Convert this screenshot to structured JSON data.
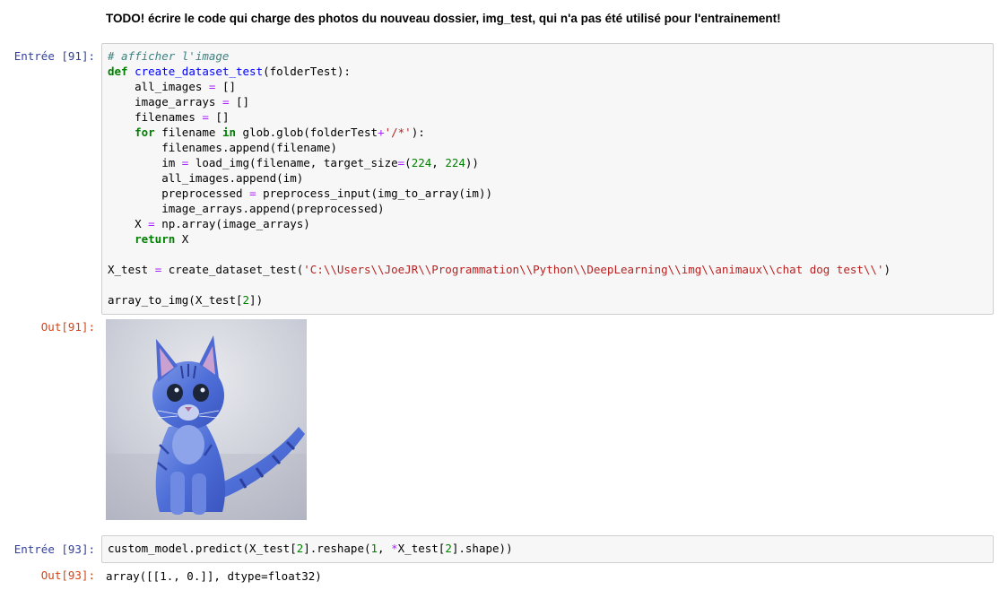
{
  "markdown": {
    "todo_text": "TODO! écrire le code qui charge des photos du nouveau dossier, img_test, qui n'a pas été utilisé pour l'entrainement!"
  },
  "cells": {
    "cell91": {
      "in_prompt": "Entrée [91]:",
      "out_prompt": "Out[91]:",
      "lines": {
        "l1": "# afficher l'image",
        "l2_def": "def",
        "l2_name": "create_dataset_test",
        "l2_rest": "(folderTest):",
        "l3_a": "all_images ",
        "l3_op": "=",
        "l3_b": " []",
        "l4_a": "image_arrays ",
        "l4_op": "=",
        "l4_b": " []",
        "l5_a": "filenames ",
        "l5_op": "=",
        "l5_b": " []",
        "l6_for": "for",
        "l6_a": " filename ",
        "l6_in": "in",
        "l6_b": " glob.glob(folderTest",
        "l6_op": "+",
        "l6_str": "'/*'",
        "l6_c": "):",
        "l7": "filenames.append(filename)",
        "l8_a": "im ",
        "l8_op": "=",
        "l8_b": " load_img(filename, target_size",
        "l8_op2": "=",
        "l8_c": "(",
        "l8_n1": "224",
        "l8_d": ", ",
        "l8_n2": "224",
        "l8_e": "))",
        "l9": "all_images.append(im)",
        "l10_a": "preprocessed ",
        "l10_op": "=",
        "l10_b": " preprocess_input(img_to_array(im))",
        "l11": "image_arrays.append(preprocessed)",
        "l12_a": "X ",
        "l12_op": "=",
        "l12_b": " np.array(image_arrays)",
        "l13_kw": "return",
        "l13_b": " X",
        "l15_a": "X_test ",
        "l15_op": "=",
        "l15_b": " create_dataset_test(",
        "l15_str": "'C:\\\\Users\\\\JoeJR\\\\Programmation\\\\Python\\\\DeepLearning\\\\img\\\\animaux\\\\chat dog test\\\\'",
        "l15_c": ")",
        "l17_a": "array_to_img(X_test[",
        "l17_n": "2",
        "l17_b": "])"
      }
    },
    "cell93": {
      "in_prompt": "Entrée [93]:",
      "out_prompt": "Out[93]:",
      "code_a": "custom_model.predict(X_test[",
      "code_n1": "2",
      "code_b": "].reshape(",
      "code_n2": "1",
      "code_c": ", ",
      "code_op": "*",
      "code_d": "X_test[",
      "code_n3": "2",
      "code_e": "].shape))",
      "output": "array([[1., 0.]], dtype=float32)"
    }
  },
  "colors": {
    "in_prompt": "#303F9F",
    "out_prompt": "#D84315",
    "comment": "#408080",
    "keyword": "#008000",
    "function_name": "#0000FF",
    "operator": "#AA22FF",
    "string": "#BA2121"
  },
  "image": {
    "subject": "blue-tinted kitten photo"
  }
}
